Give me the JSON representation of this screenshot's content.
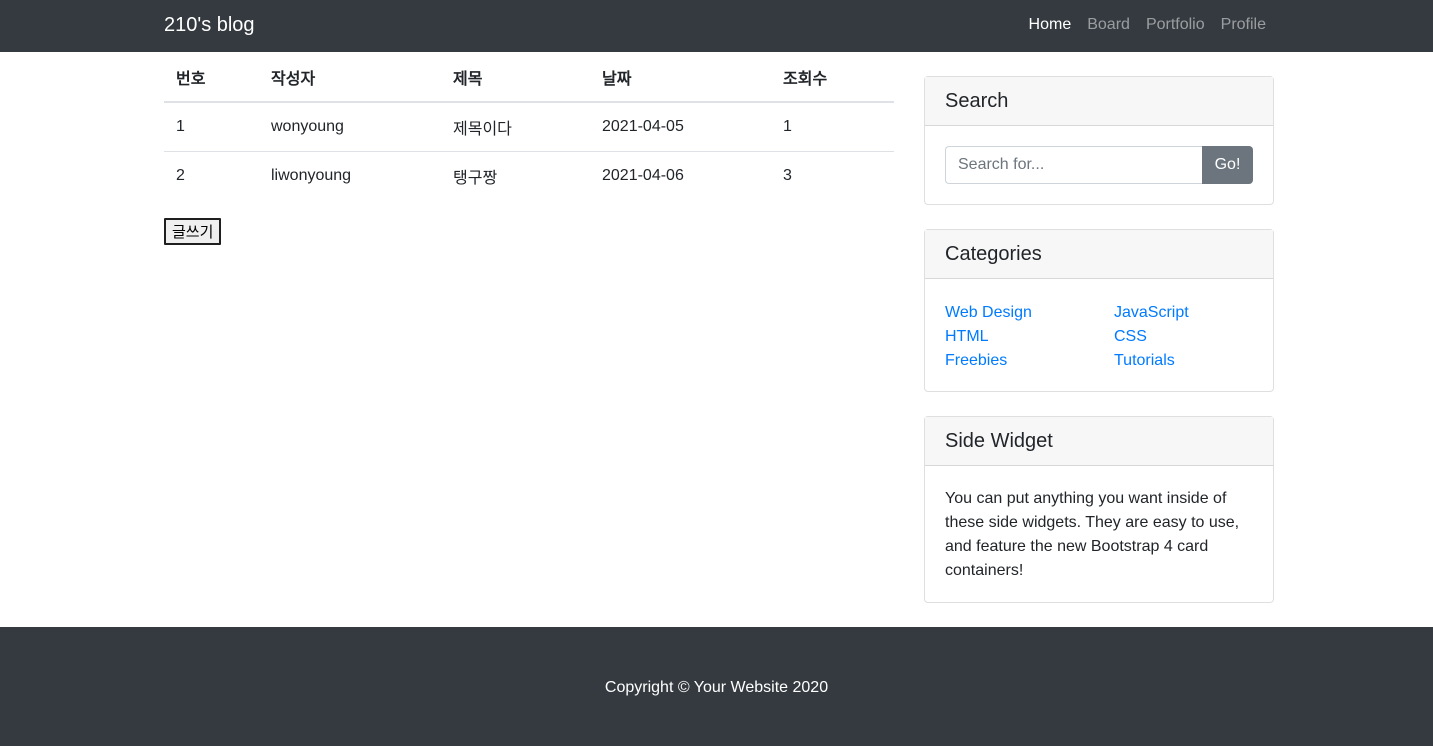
{
  "navbar": {
    "brand": "210's blog",
    "links": [
      {
        "label": "Home",
        "active": true
      },
      {
        "label": "Board",
        "active": false
      },
      {
        "label": "Portfolio",
        "active": false
      },
      {
        "label": "Profile",
        "active": false
      }
    ]
  },
  "board": {
    "columns": [
      "번호",
      "작성자",
      "제목",
      "날짜",
      "조회수"
    ],
    "rows": [
      {
        "num": "1",
        "author": "wonyoung",
        "title": "제목이다",
        "date": "2021-04-05",
        "views": "1"
      },
      {
        "num": "2",
        "author": "liwonyoung",
        "title": "탱구짱",
        "date": "2021-04-06",
        "views": "3"
      }
    ],
    "write_button": "글쓰기"
  },
  "sidebar": {
    "search": {
      "title": "Search",
      "placeholder": "Search for...",
      "button": "Go!"
    },
    "categories": {
      "title": "Categories",
      "items": [
        "Web Design",
        "JavaScript",
        "HTML",
        "CSS",
        "Freebies",
        "Tutorials"
      ]
    },
    "widget": {
      "title": "Side Widget",
      "text": "You can put anything you want inside of these side widgets. They are easy to use, and feature the new Bootstrap 4 card containers!"
    }
  },
  "footer": {
    "copyright": "Copyright © Your Website 2020"
  },
  "colors": {
    "navbar_bg": "#343a40",
    "link": "#007bff",
    "secondary_button": "#6c757d",
    "card_header_bg": "#f7f7f7"
  }
}
